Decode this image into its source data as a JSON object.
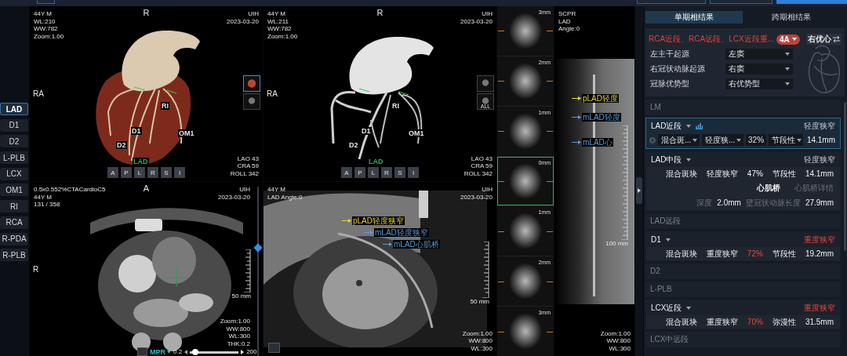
{
  "sidebar": {
    "items": [
      {
        "label": "LAD",
        "selected": true
      },
      {
        "label": "D1",
        "selected": false
      },
      {
        "label": "D2",
        "selected": false
      },
      {
        "label": "L-PLB",
        "selected": false
      },
      {
        "label": "LCX",
        "selected": false
      },
      {
        "label": "OM1",
        "selected": false
      },
      {
        "label": "RI",
        "selected": false
      },
      {
        "label": "RCA",
        "selected": false
      },
      {
        "label": "R-PDA",
        "selected": false
      },
      {
        "label": "R-PLB",
        "selected": false
      }
    ]
  },
  "viewports": [
    {
      "kind": "vr",
      "info_left": [
        "44Y M",
        "WL:210",
        "WW:782",
        "Zoom:1.00"
      ],
      "top_label": "R",
      "info_right": [
        "UIH",
        "2023-03-20"
      ],
      "side_label": "RA",
      "vessel_labels": [
        {
          "text": "RI",
          "selected": false
        },
        {
          "text": "D1",
          "selected": false
        },
        {
          "text": "OM1",
          "selected": false
        },
        {
          "text": "D2",
          "selected": false
        },
        {
          "text": "LAD",
          "selected": true
        }
      ],
      "view_info": [
        "LAO 43",
        "CRA 59",
        "ROLL 342"
      ],
      "orientation_buttons": [
        "A",
        "P",
        "L",
        "R",
        "S",
        "I"
      ],
      "thumbnails": [
        {
          "selected": true
        },
        {
          "selected": false
        }
      ]
    },
    {
      "kind": "mip",
      "info_left": [
        "44Y M",
        "WL:211",
        "WW:782",
        "Zoom:1.00"
      ],
      "top_label": "R",
      "info_right": [
        "UIH",
        "2023-03-20"
      ],
      "side_label": "RA",
      "vessel_labels": [
        {
          "text": "RI",
          "selected": false
        },
        {
          "text": "D1",
          "selected": false
        },
        {
          "text": "OM1",
          "selected": false
        },
        {
          "text": "D2",
          "selected": false
        },
        {
          "text": "LAD",
          "selected": true
        }
      ],
      "view_info": [
        "LAO 43",
        "CRA 59",
        "ROLL 342"
      ],
      "orientation_buttons": [
        "A",
        "P",
        "L",
        "R",
        "S",
        "I"
      ],
      "thumbnails": [
        {
          "selected": false
        },
        {
          "label": "ALL",
          "selected": false
        }
      ]
    },
    {
      "kind": "mpr",
      "info_left": [
        "0.5x0.552%CTACardioC5",
        "44Y M",
        "131 / 358"
      ],
      "top_label": "A",
      "info_right": [
        "UIH",
        "2023-03-20"
      ],
      "side_label": "R",
      "scale": "50 mm",
      "info_bottom": [
        "Zoom:1.00",
        "WW:800",
        "WL:300",
        "THK:0.2"
      ],
      "slice_slider": {
        "level": 0.64
      },
      "toolbar": {
        "mode": "MPR",
        "thickness": "0.2",
        "level": 0.05,
        "max": "200"
      }
    },
    {
      "kind": "cpr",
      "info_left": [
        "44Y M",
        "LAD Angle:0"
      ],
      "info_right": [
        "UIH",
        "2023-03-20"
      ],
      "annotations": [
        {
          "text": "pLAD轻度狭窄",
          "color": "#e8d43a"
        },
        {
          "text": "mLAD轻度狭窄",
          "color": "#5b9bd5"
        },
        {
          "text": "mLAD心肌桥",
          "color": "#5b9bd5"
        }
      ],
      "scale": "50 mm",
      "info_bottom": [
        "Zoom:1.00",
        "WW:800",
        "WL:300"
      ]
    }
  ],
  "slice_strip": {
    "slices": [
      {
        "label": "3mm",
        "selected": false
      },
      {
        "label": "2mm",
        "selected": false
      },
      {
        "label": "1mm",
        "selected": false
      },
      {
        "label": "0mm",
        "selected": true
      },
      {
        "label": "1mm",
        "selected": false
      },
      {
        "label": "2mm",
        "selected": false
      },
      {
        "label": "3mm",
        "selected": false
      }
    ]
  },
  "scpr": {
    "info_left": [
      "SCPR",
      "LAD",
      "Angle:0"
    ],
    "annotations": [
      {
        "text": "pLAD轻度",
        "color": "#e8d43a"
      },
      {
        "text": "mLAD轻度",
        "color": "#5b9bd5"
      },
      {
        "text": "mLAD心",
        "color": "#5b9bd5"
      }
    ],
    "scale": "100 mm",
    "info_bottom": [
      "Zoom:1.00",
      "WW:800",
      "WL:300"
    ]
  },
  "report": {
    "tabs": [
      {
        "label": "单期相结果",
        "selected": true
      },
      {
        "label": "跨期相结果",
        "selected": false
      }
    ],
    "summary": {
      "text": "RCA近段、RCA远段、LCX近段重...",
      "grade": "4A",
      "dominance_button": "右优心",
      "fields": [
        {
          "label": "左主干起源",
          "value": "左窦"
        },
        {
          "label": "右冠状动脉起源",
          "value": "右窦"
        },
        {
          "label": "冠脉优势型",
          "value": "右优势型"
        }
      ]
    },
    "segments": [
      {
        "name": "LM",
        "kind": "empty"
      },
      {
        "name": "LAD近段",
        "kind": "editing",
        "selected": true,
        "result": "轻度狭窄",
        "severe": false,
        "edit": {
          "plaque": "混合斑...",
          "stenosis": "轻度狭...",
          "percent": "32",
          "unit": "%",
          "morphology": "节段性",
          "length": "14.1mm"
        }
      },
      {
        "name": "LAD中段",
        "kind": "finding",
        "selected": false,
        "result": "轻度狭窄",
        "severe": false,
        "details": [
          "混合斑块",
          "轻度狭窄",
          "47%",
          "节段性",
          "14.1mm"
        ],
        "bridge": {
          "label": "心肌桥",
          "link": "心肌桥详情",
          "depth_label": "深度",
          "depth": "2.0mm",
          "length_label": "壁冠状动脉长度",
          "length": "27.9mm"
        }
      },
      {
        "name": "LAD远段",
        "kind": "empty"
      },
      {
        "name": "D1",
        "kind": "finding",
        "selected": false,
        "result": "重度狭窄",
        "severe": true,
        "details": [
          "混合斑块",
          "重度狭窄",
          "72%",
          "节段性",
          "19.2mm"
        ]
      },
      {
        "name": "D2",
        "kind": "empty"
      },
      {
        "name": "L-PLB",
        "kind": "empty"
      },
      {
        "name": "LCX近段",
        "kind": "finding",
        "selected": false,
        "result": "重度狭窄",
        "severe": true,
        "details": [
          "混合斑块",
          "重度狭窄",
          "70%",
          "弥漫性",
          "31.5mm"
        ]
      },
      {
        "name": "LCX中远段",
        "kind": "empty"
      }
    ]
  }
}
